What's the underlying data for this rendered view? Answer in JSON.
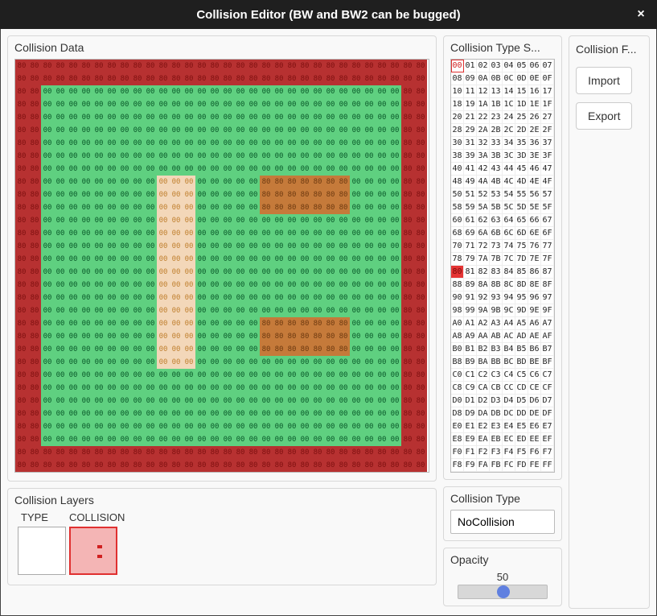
{
  "window": {
    "title": "Collision Editor (BW and BW2 can be bugged)",
    "close_label": "×"
  },
  "panels": {
    "collision_data": "Collision Data",
    "collision_layers": "Collision Layers",
    "collision_type_selector": "Collision Type S...",
    "collision_type": "Collision Type",
    "opacity": "Opacity",
    "collision_file": "Collision F..."
  },
  "layers": {
    "headers": [
      "TYPE",
      "COLLISION"
    ],
    "items": [
      {
        "name": "type-layer"
      },
      {
        "name": "collision-layer",
        "selected": true
      }
    ]
  },
  "collision_type_value": "NoCollision",
  "opacity_value": 50,
  "buttons": {
    "import": "Import",
    "export": "Export"
  },
  "cell_values": {
    "zero": "00",
    "eighty": "80"
  },
  "grid": {
    "size": 32,
    "base": {
      "comment": "value 80 (red) forms outer ring rows 0-1 and 30-31, and cols 0-1 and 30-31; everything else 00 (green)",
      "ring_value": "80",
      "fill_value": "00"
    },
    "overlays": {
      "comment": "orange/beige overlay tint regions (purely visual type-layer overlay; underlying cell values unchanged)",
      "regions": [
        {
          "rows": [
            9,
            23
          ],
          "cols": [
            11,
            13
          ],
          "style": "cov1",
          "underlying": "00"
        },
        {
          "rows": [
            9,
            11
          ],
          "cols": [
            19,
            25
          ],
          "style": "cov2",
          "underlying": "80"
        },
        {
          "rows": [
            20,
            22
          ],
          "cols": [
            19,
            25
          ],
          "style": "cov2",
          "underlying": "80"
        }
      ]
    }
  },
  "selector": {
    "columns": 8,
    "values_hex_range": [
      0,
      255
    ],
    "highlighted": {
      "outlined": "00",
      "filled": "80"
    }
  }
}
